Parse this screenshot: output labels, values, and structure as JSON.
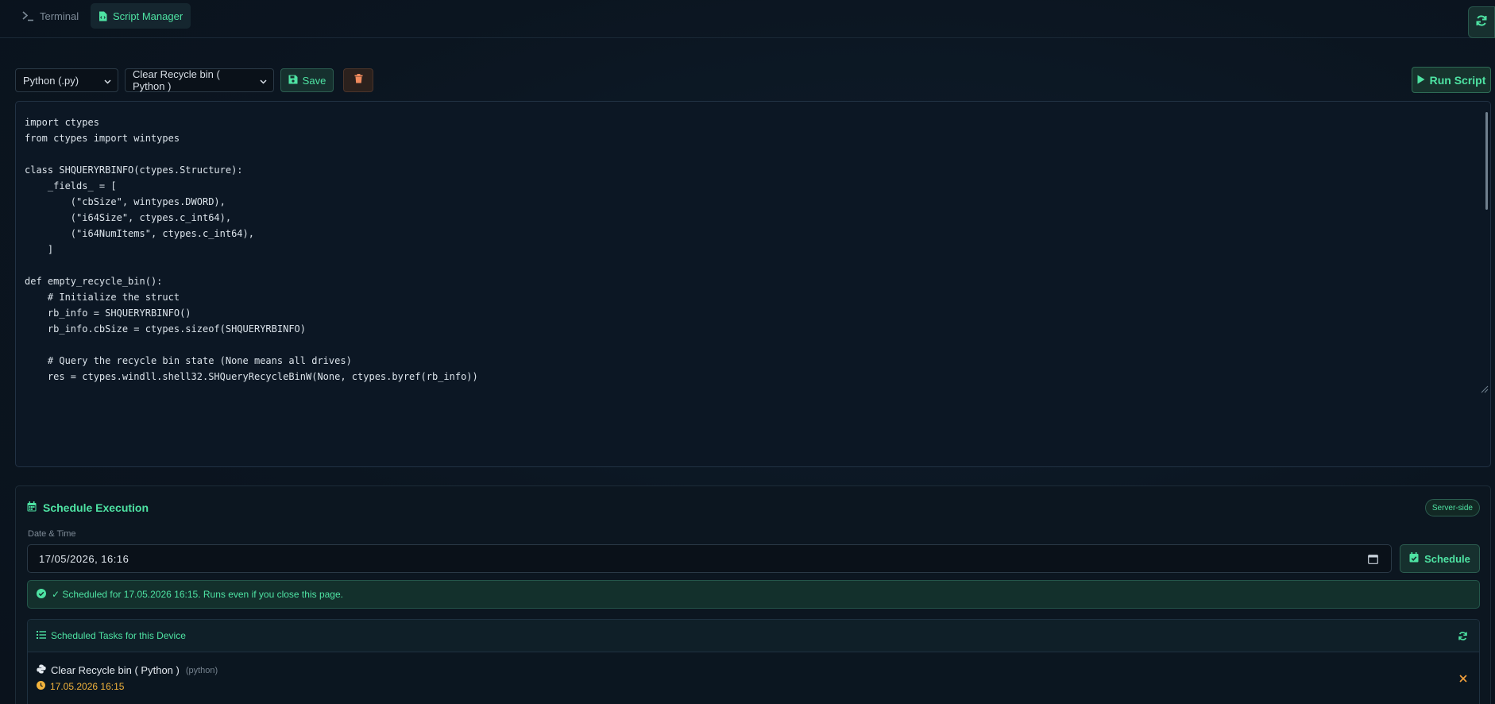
{
  "tabs": [
    {
      "label": "Terminal",
      "active": false
    },
    {
      "label": "Script Manager",
      "active": true
    }
  ],
  "toolbar": {
    "language": "Python (.py)",
    "script": "Clear Recycle bin ( Python )",
    "save_label": "Save",
    "run_label": "Run Script"
  },
  "editor": {
    "code": "import ctypes\nfrom ctypes import wintypes\n\nclass SHQUERYRBINFO(ctypes.Structure):\n    _fields_ = [\n        (\"cbSize\", wintypes.DWORD),\n        (\"i64Size\", ctypes.c_int64),\n        (\"i64NumItems\", ctypes.c_int64),\n    ]\n\ndef empty_recycle_bin():\n    # Initialize the struct\n    rb_info = SHQUERYRBINFO()\n    rb_info.cbSize = ctypes.sizeof(SHQUERYRBINFO)\n\n    # Query the recycle bin state (None means all drives)\n    res = ctypes.windll.shell32.SHQueryRecycleBinW(None, ctypes.byref(rb_info))"
  },
  "schedule": {
    "title": "Schedule Execution",
    "badge": "Server-side",
    "datetime_label": "Date & Time",
    "datetime_value": "17/05/2026, 16:16",
    "schedule_label": "Schedule",
    "alert": "✓ Scheduled for 17.05.2026 16:15. Runs even if you close this page."
  },
  "tasks": {
    "title": "Scheduled Tasks for this Device",
    "items": [
      {
        "name": "Clear Recycle bin ( Python )",
        "type": "(python)",
        "time": "17.05.2026 16:15"
      }
    ]
  },
  "colors": {
    "accent": "#4ee3a3",
    "warning": "#f2b33c",
    "background": "#0b1420"
  }
}
